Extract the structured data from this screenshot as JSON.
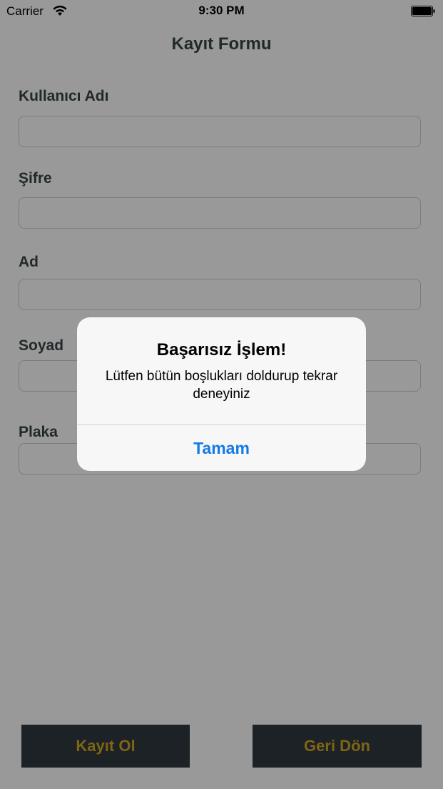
{
  "status_bar": {
    "carrier": "Carrier",
    "time": "9:30 PM"
  },
  "form": {
    "title": "Kayıt Formu",
    "fields": [
      {
        "label": "Kullanıcı Adı",
        "value": ""
      },
      {
        "label": "Şifre",
        "value": ""
      },
      {
        "label": "Ad",
        "value": ""
      },
      {
        "label": "Soyad",
        "value": ""
      },
      {
        "label": "Plaka",
        "value": ""
      }
    ],
    "register_button": "Kayıt Ol",
    "back_button": "Geri Dön"
  },
  "alert": {
    "title": "Başarısız İşlem!",
    "message": "Lütfen bütün boşlukları doldurup tekrar deneyiniz",
    "button": "Tamam"
  },
  "colors": {
    "button_bg": "#313a40",
    "button_text": "#d2a724",
    "alert_button": "#1479e8",
    "overlay": "rgba(0,0,0,0.40)"
  }
}
